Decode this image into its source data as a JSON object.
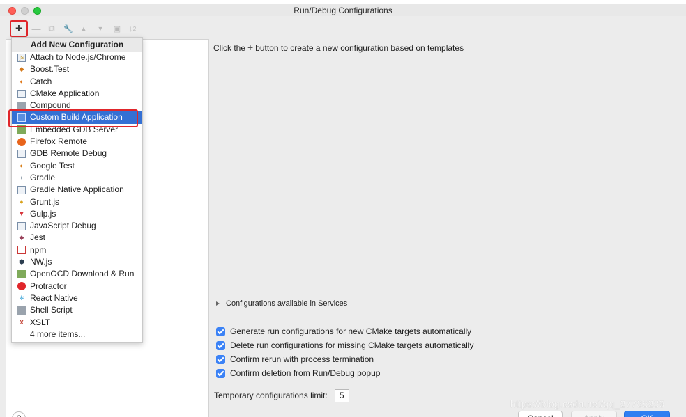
{
  "window": {
    "title": "Run/Debug Configurations"
  },
  "toolbar": {
    "add_glyph": "+",
    "remove_glyph": "—",
    "copy_glyph": "⧉",
    "edit_glyph": "🔧",
    "up_glyph": "▲",
    "down_glyph": "▼",
    "folder_glyph": "▣",
    "sort_glyph": "↓",
    "sort_sub": "2"
  },
  "popup": {
    "header": "Add New Configuration",
    "items": [
      {
        "label": "Attach to Node.js/Chrome",
        "icon": "nodejs-attach-icon"
      },
      {
        "label": "Boost.Test",
        "icon": "boost-test-icon"
      },
      {
        "label": "Catch",
        "icon": "catch-icon"
      },
      {
        "label": "CMake Application",
        "icon": "cmake-app-icon"
      },
      {
        "label": "Compound",
        "icon": "compound-icon"
      },
      {
        "label": "Custom Build Application",
        "icon": "custom-build-icon",
        "selected": true
      },
      {
        "label": "Embedded GDB Server",
        "icon": "embedded-gdb-icon"
      },
      {
        "label": "Firefox Remote",
        "icon": "firefox-icon"
      },
      {
        "label": "GDB Remote Debug",
        "icon": "gdb-remote-icon"
      },
      {
        "label": "Google Test",
        "icon": "google-test-icon"
      },
      {
        "label": "Gradle",
        "icon": "gradle-icon"
      },
      {
        "label": "Gradle Native Application",
        "icon": "gradle-native-icon"
      },
      {
        "label": "Grunt.js",
        "icon": "grunt-icon"
      },
      {
        "label": "Gulp.js",
        "icon": "gulp-icon"
      },
      {
        "label": "JavaScript Debug",
        "icon": "js-debug-icon"
      },
      {
        "label": "Jest",
        "icon": "jest-icon"
      },
      {
        "label": "npm",
        "icon": "npm-icon"
      },
      {
        "label": "NW.js",
        "icon": "nwjs-icon"
      },
      {
        "label": "OpenOCD Download & Run",
        "icon": "openocd-icon"
      },
      {
        "label": "Protractor",
        "icon": "protractor-icon"
      },
      {
        "label": "React Native",
        "icon": "react-native-icon"
      },
      {
        "label": "Shell Script",
        "icon": "shell-script-icon"
      },
      {
        "label": "XSLT",
        "icon": "xslt-icon"
      }
    ],
    "more": "4 more items..."
  },
  "main": {
    "hint_before": "Click the",
    "hint_plus": "+",
    "hint_after": "button to create a new configuration based on templates",
    "services_label": "Configurations available in Services",
    "checks": [
      {
        "label": "Generate run configurations for new CMake targets automatically",
        "checked": true
      },
      {
        "label": "Delete run configurations for missing CMake targets automatically",
        "checked": true
      },
      {
        "label": "Confirm rerun with process termination",
        "checked": true
      },
      {
        "label": "Confirm deletion from Run/Debug popup",
        "checked": true
      }
    ],
    "limit_label": "Temporary configurations limit:",
    "limit_value": "5"
  },
  "footer": {
    "help": "?",
    "cancel": "Cancel",
    "apply": "Apply",
    "ok": "OK"
  },
  "watermark": "https://blog.csdn.net/qq_27785239",
  "colors": {
    "accent": "#3470d4",
    "highlight": "#e0262b",
    "checkbox": "#3b82f6"
  }
}
